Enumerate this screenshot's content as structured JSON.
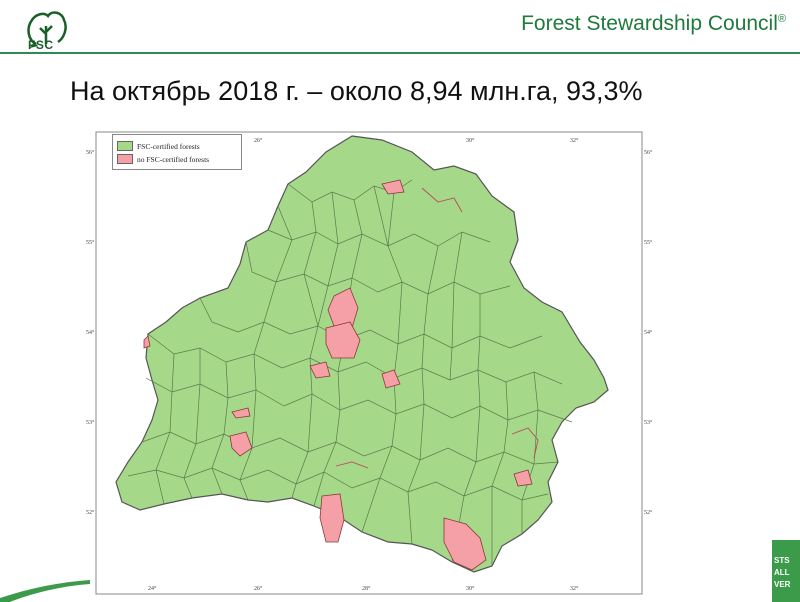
{
  "header": {
    "logo_text": "FSC",
    "org_name": "Forest Stewardship Council",
    "org_reg": "®"
  },
  "slide": {
    "title": "На октябрь 2018 г. – около 8,94 млн.га, 93,3%"
  },
  "map": {
    "legend": [
      {
        "label": "FSC-certified forests",
        "color": "#a5d889"
      },
      {
        "label": "no FSC-certified forests",
        "color": "#f4a0a6"
      }
    ],
    "lat_labels": [
      "56°",
      "55°",
      "54°",
      "53°",
      "52°"
    ],
    "lon_labels": [
      "24°",
      "26°",
      "28°",
      "30°",
      "32°"
    ],
    "colors": {
      "certified": "#a5d889",
      "non_certified": "#f4a0a6",
      "border": "#555555",
      "frame": "#888888"
    }
  },
  "corner_badge": {
    "lines": [
      "STS",
      "ALL",
      "VER"
    ],
    "color": "#3c9b4a"
  }
}
